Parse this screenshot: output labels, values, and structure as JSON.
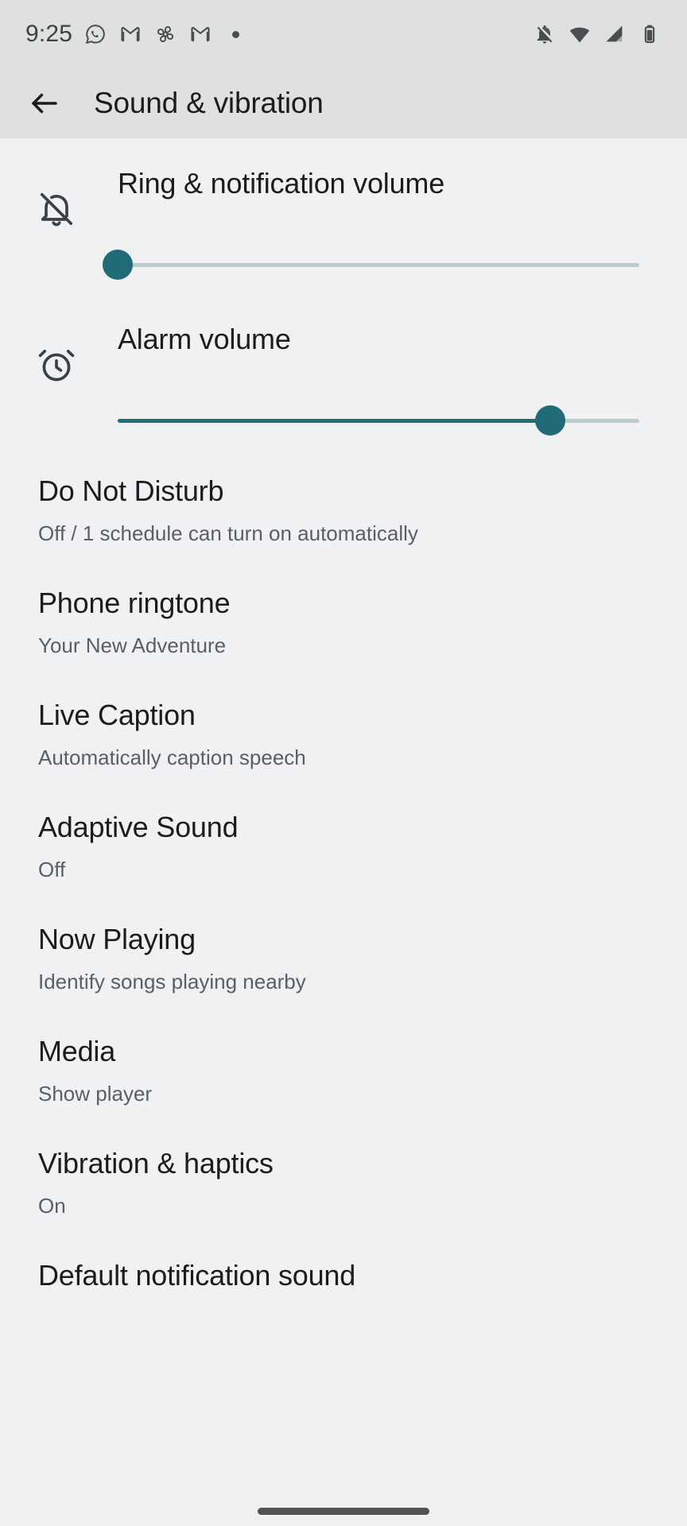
{
  "status_bar": {
    "time": "9:25",
    "left_icons": [
      {
        "name": "whatsapp-icon",
        "label": "WhatsApp"
      },
      {
        "name": "gmail-icon",
        "label": "Gmail"
      },
      {
        "name": "pinwheel-icon",
        "label": "Pinwheel"
      },
      {
        "name": "gmail-icon-2",
        "label": "Gmail"
      },
      {
        "name": "more-notifications-dot-icon",
        "label": "More notifications"
      }
    ],
    "right_icons": [
      {
        "name": "notifications-silenced-icon",
        "label": "Notifications silenced"
      },
      {
        "name": "wifi-icon",
        "label": "Wi-Fi"
      },
      {
        "name": "cellular-signal-icon",
        "label": "Mobile signal"
      },
      {
        "name": "battery-icon",
        "label": "Battery"
      }
    ]
  },
  "app_bar": {
    "back_label": "Back",
    "title": "Sound & vibration"
  },
  "volume_sliders": [
    {
      "id": "ring-notification-volume",
      "label": "Ring & notification volume",
      "icon": "notifications-off-icon",
      "value": 0,
      "min": 0,
      "max": 100
    },
    {
      "id": "alarm-volume",
      "label": "Alarm volume",
      "icon": "alarm-clock-icon",
      "value": 83,
      "min": 0,
      "max": 100
    }
  ],
  "settings_items": [
    {
      "id": "do-not-disturb",
      "title": "Do Not Disturb",
      "subtitle": "Off / 1 schedule can turn on automatically"
    },
    {
      "id": "phone-ringtone",
      "title": "Phone ringtone",
      "subtitle": "Your New Adventure"
    },
    {
      "id": "live-caption",
      "title": "Live Caption",
      "subtitle": "Automatically caption speech"
    },
    {
      "id": "adaptive-sound",
      "title": "Adaptive Sound",
      "subtitle": "Off"
    },
    {
      "id": "now-playing",
      "title": "Now Playing",
      "subtitle": "Identify songs playing nearby"
    },
    {
      "id": "media",
      "title": "Media",
      "subtitle": "Show player"
    },
    {
      "id": "vibration-haptics",
      "title": "Vibration & haptics",
      "subtitle": "On"
    },
    {
      "id": "default-notification-sound",
      "title": "Default notification sound",
      "subtitle": ""
    }
  ],
  "colors": {
    "accent": "#216b78",
    "track": "#b9cbcd",
    "background": "#eff1f3",
    "bar_background": "#dfe1e1",
    "title_text": "#1b1c1e",
    "secondary_text": "#5b5e62"
  }
}
